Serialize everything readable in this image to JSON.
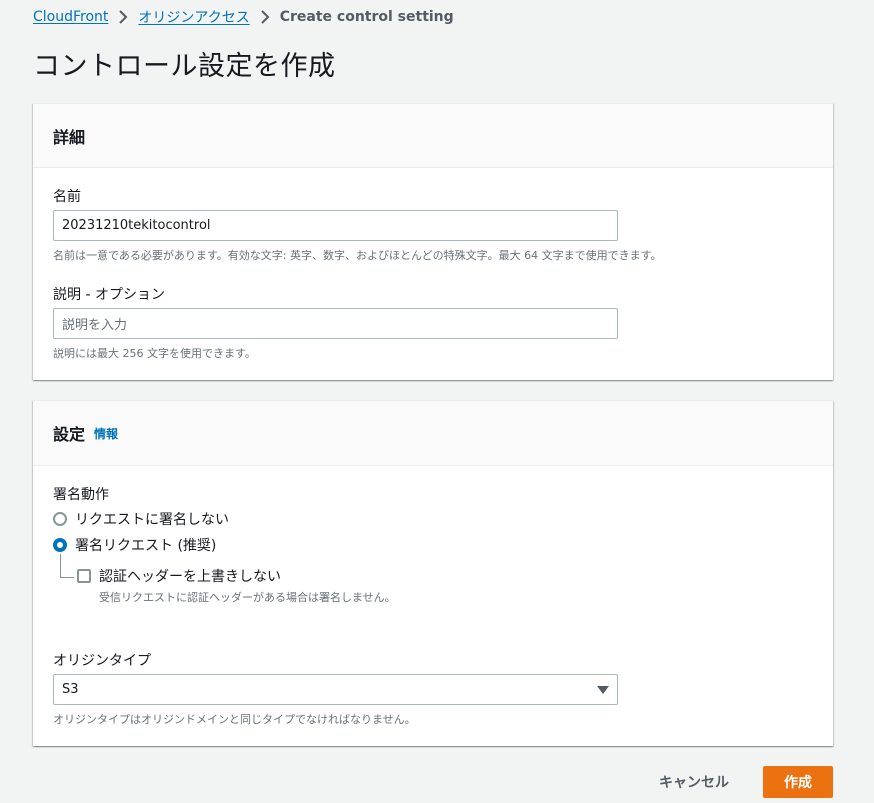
{
  "breadcrumb": {
    "items": [
      "CloudFront",
      "オリジンアクセス"
    ],
    "current": "Create control setting"
  },
  "page": {
    "title": "コントロール設定を作成"
  },
  "details": {
    "heading": "詳細",
    "name": {
      "label": "名前",
      "value": "20231210tekitocontrol",
      "hint": "名前は一意である必要があります。有効な文字: 英字、数字、およびほとんどの特殊文字。最大 64 文字まで使用できます。"
    },
    "description": {
      "label": "説明 - オプション",
      "placeholder": "説明を入力",
      "hint": "説明には最大 256 文字を使用できます。"
    }
  },
  "settings": {
    "heading": "設定",
    "info_link": "情報",
    "signing": {
      "label": "署名動作",
      "options": [
        {
          "label": "リクエストに署名しない",
          "checked": false
        },
        {
          "label": "署名リクエスト (推奨)",
          "checked": true
        }
      ],
      "override": {
        "label": "認証ヘッダーを上書きしない",
        "checked": false,
        "hint": "受信リクエストに認証ヘッダーがある場合は署名しません。"
      }
    },
    "origin_type": {
      "label": "オリジンタイプ",
      "value": "S3",
      "hint": "オリジンタイプはオリジンドメインと同じタイプでなければなりません。"
    }
  },
  "actions": {
    "cancel": "キャンセル",
    "create": "作成"
  },
  "colors": {
    "link": "#0073bb",
    "primary": "#ec7211",
    "background": "#f2f3f3"
  },
  "icons": {
    "breadcrumb_separator": "chevron-right-icon",
    "select_caret": "caret-down-icon"
  }
}
